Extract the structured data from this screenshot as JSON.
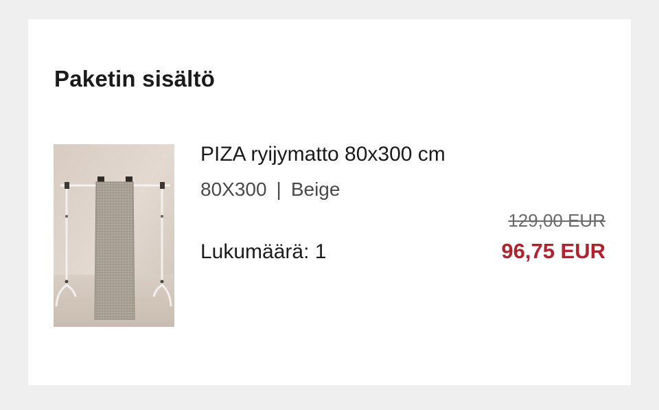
{
  "section": {
    "title": "Paketin sisältö"
  },
  "product": {
    "name": "PIZA ryijymatto 80x300 cm",
    "size": "80X300",
    "separator": "|",
    "color": "Beige",
    "image_icon": "rug-product-photo",
    "quantity_label": "Lukumäärä:",
    "quantity_value": "1",
    "original_price": "129,00 EUR",
    "sale_price": "96,75 EUR"
  },
  "colors": {
    "sale_price": "#b3222c",
    "background": "#efefef",
    "card": "#ffffff"
  }
}
